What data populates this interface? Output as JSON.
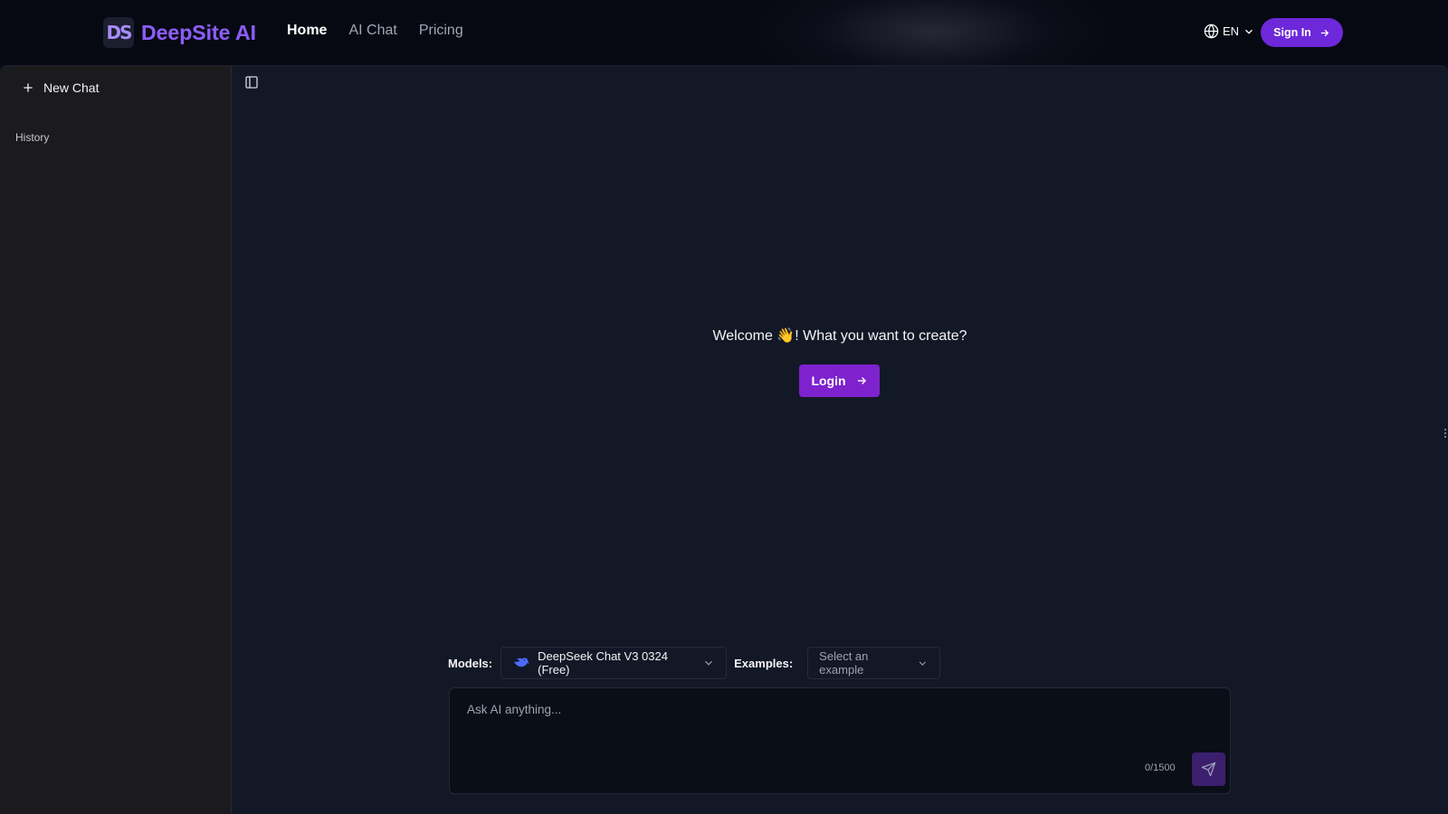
{
  "header": {
    "brand": "DeepSite AI",
    "brand_mark": "DS",
    "nav": [
      {
        "label": "Home",
        "active": true
      },
      {
        "label": "AI Chat",
        "active": false
      },
      {
        "label": "Pricing",
        "active": false
      }
    ],
    "language": "EN",
    "sign_in_label": "Sign In"
  },
  "sidebar": {
    "new_chat_label": "New Chat",
    "history_label": "History"
  },
  "main": {
    "welcome_text": "Welcome 👋! What you want to create?",
    "login_label": "Login",
    "models_label": "Models:",
    "model_selected": "DeepSeek Chat V3 0324 (Free)",
    "examples_label": "Examples:",
    "examples_placeholder": "Select an example",
    "prompt_placeholder": "Ask AI anything...",
    "char_counter": "0/1500"
  },
  "icons": {
    "globe": "globe-icon",
    "chevron": "chevron-down-icon",
    "arrow": "arrow-right-icon",
    "plus": "plus-icon",
    "sidebar_toggle": "sidebar-toggle-icon",
    "model": "deepseek-whale-icon",
    "send": "send-icon"
  },
  "colors": {
    "accent": "#7e22ce",
    "sign_in": "#6d28d9",
    "brand_gradient_start": "#a855f7",
    "brand_gradient_end": "#6366f1",
    "page_bg": "#131827",
    "sidebar_bg": "#1b1b1d"
  }
}
